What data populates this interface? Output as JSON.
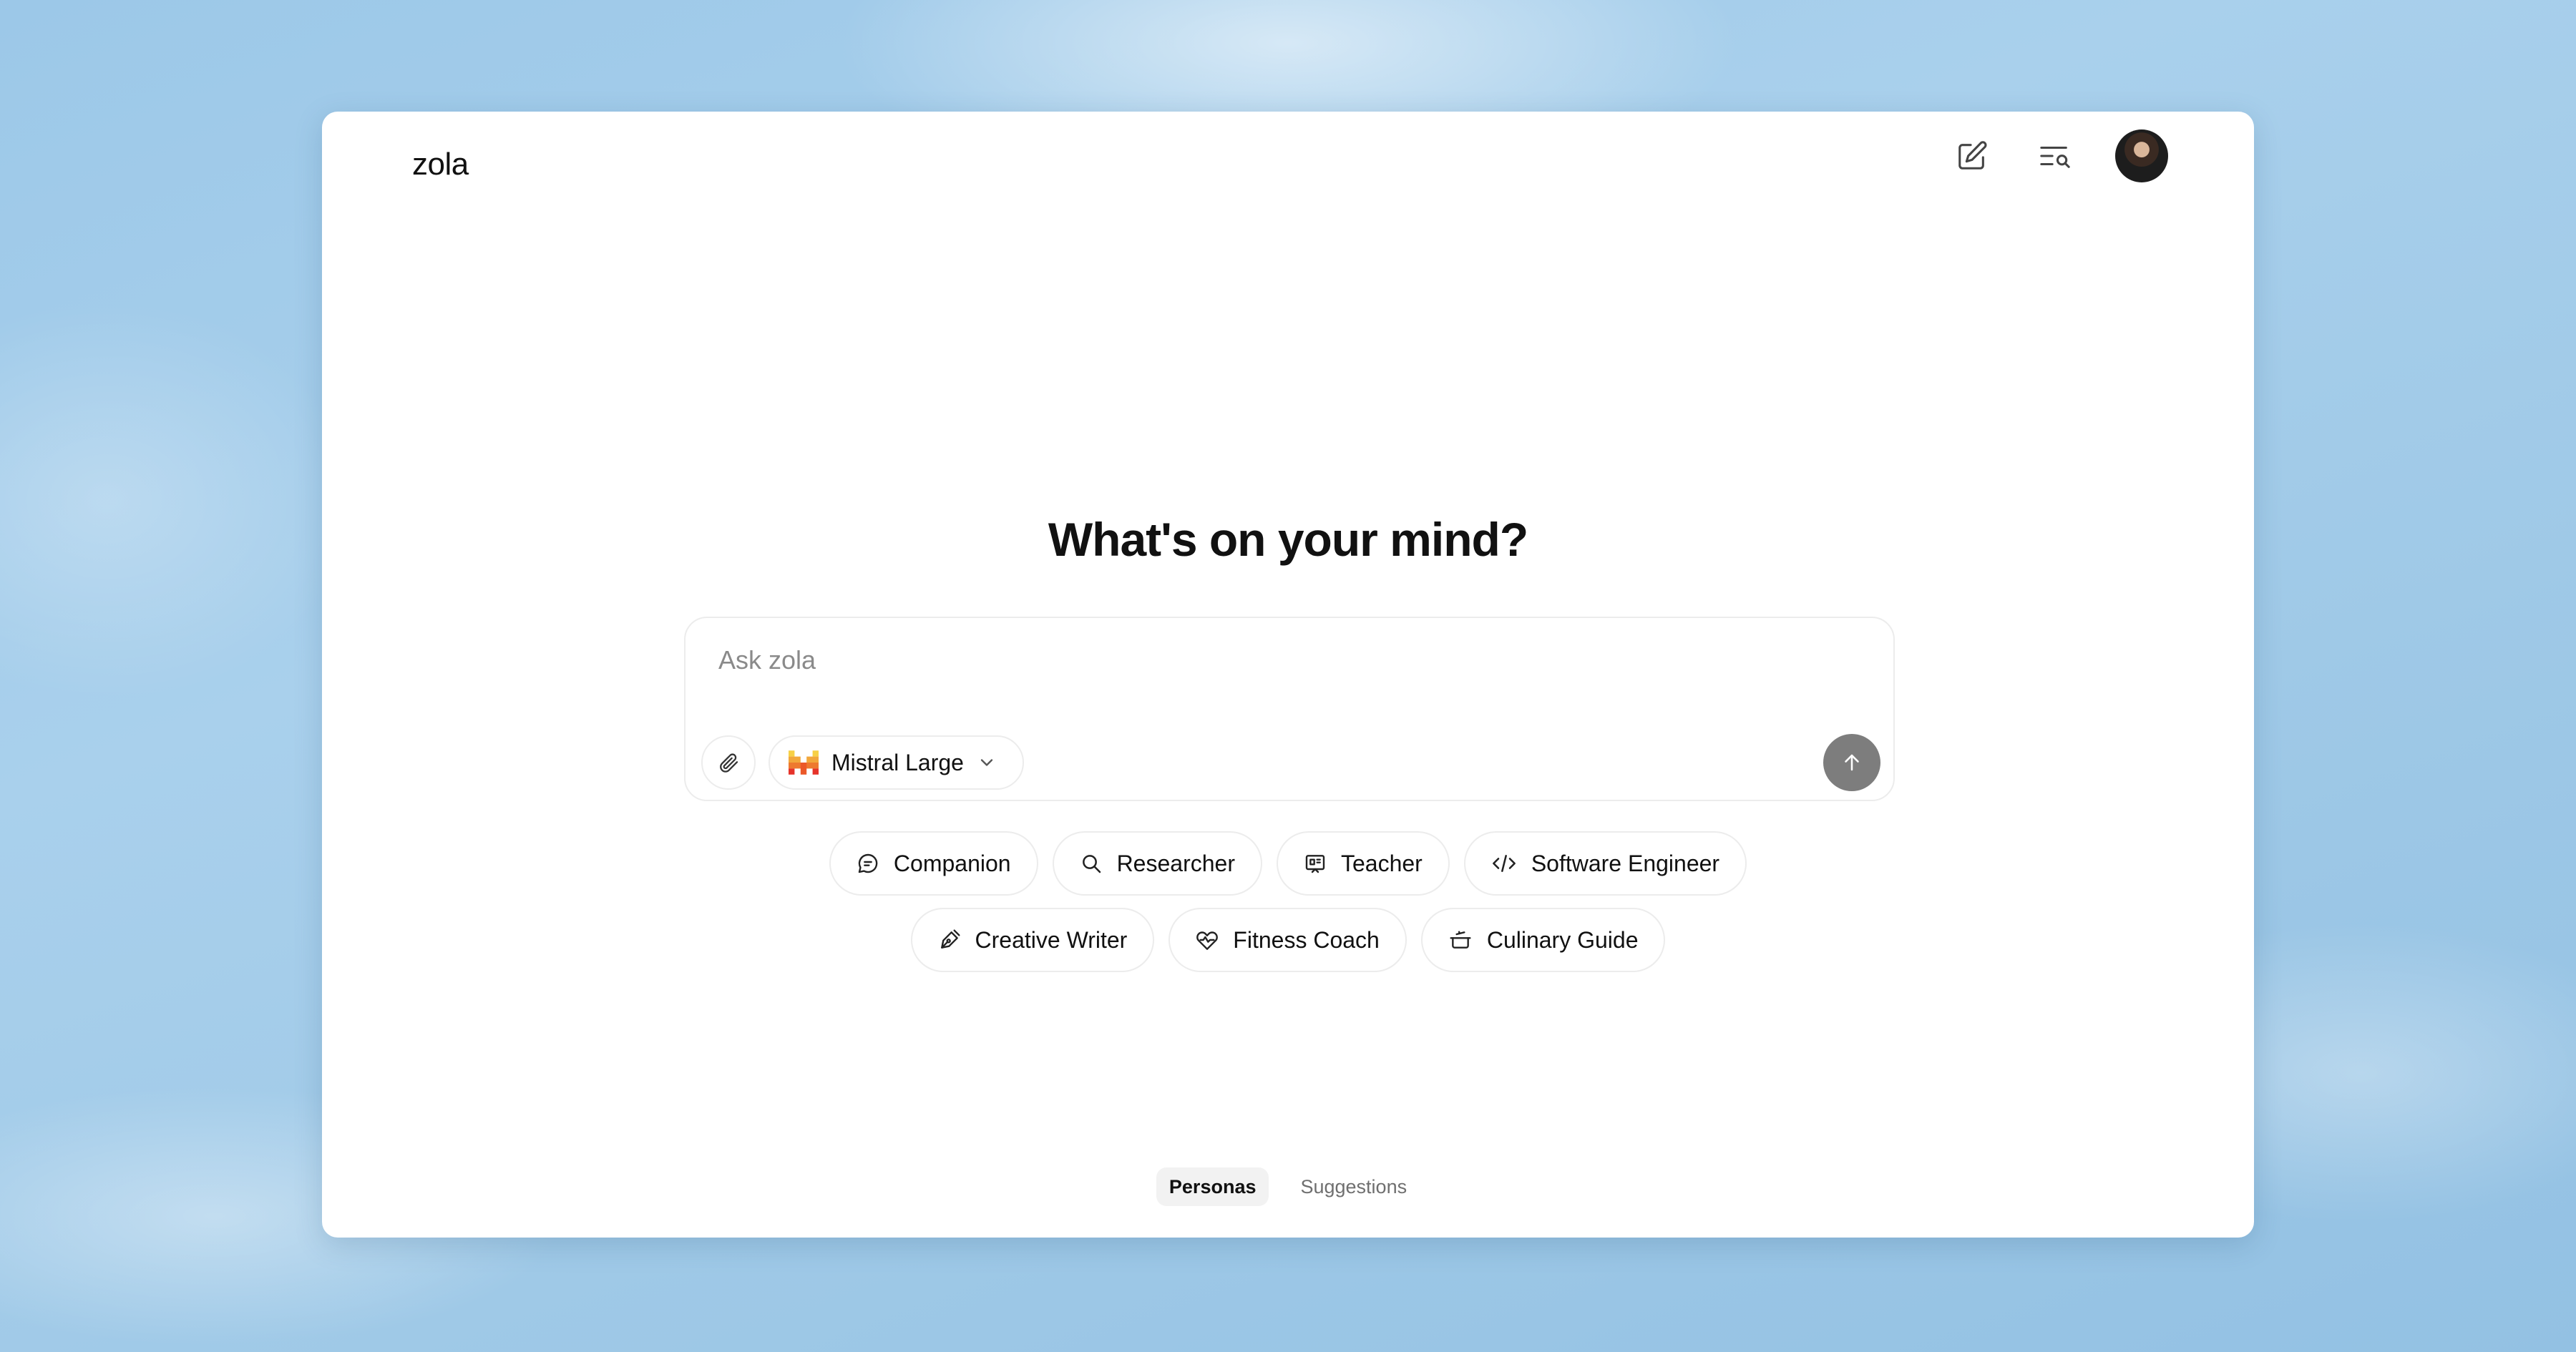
{
  "app": {
    "logo": "zola"
  },
  "header": {
    "new_chat_icon": "pencil-square-icon",
    "search_history_icon": "list-search-icon",
    "avatar": "user-avatar"
  },
  "main": {
    "headline": "What's on your mind?",
    "composer": {
      "placeholder": "Ask zola",
      "value": "",
      "attach_icon": "paperclip-icon",
      "model": {
        "label": "Mistral Large",
        "icon": "mistral-logo-icon",
        "chevron": "chevron-down-icon"
      },
      "send_icon": "arrow-up-icon"
    },
    "personas": [
      {
        "label": "Companion",
        "icon": "chat-bubble-icon"
      },
      {
        "label": "Researcher",
        "icon": "search-icon"
      },
      {
        "label": "Teacher",
        "icon": "presentation-board-icon"
      },
      {
        "label": "Software Engineer",
        "icon": "code-icon"
      },
      {
        "label": "Creative Writer",
        "icon": "pen-nib-icon"
      },
      {
        "label": "Fitness Coach",
        "icon": "heart-pulse-icon"
      },
      {
        "label": "Culinary Guide",
        "icon": "cooking-pot-icon"
      }
    ]
  },
  "tabs": [
    {
      "label": "Personas",
      "active": true
    },
    {
      "label": "Suggestions",
      "active": false
    }
  ],
  "colors": {
    "send_button": "#7d7d7d",
    "border": "#ececec",
    "text": "#111111"
  }
}
